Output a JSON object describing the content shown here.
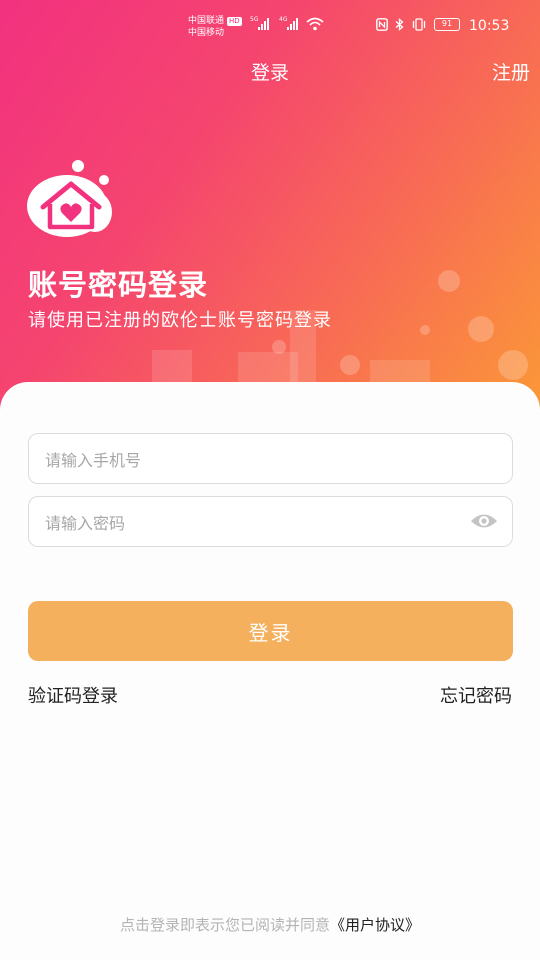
{
  "status_bar": {
    "carrier1": "中国联通",
    "carrier1_badge": "HD",
    "carrier2": "中国移动",
    "net1": "5G",
    "net2": "4G",
    "battery": "91",
    "time": "10:53"
  },
  "nav": {
    "title": "登录",
    "register": "注册"
  },
  "hero": {
    "title": "账号密码登录",
    "subtitle": "请使用已注册的欧伦士账号密码登录"
  },
  "form": {
    "phone_placeholder": "请输入手机号",
    "password_placeholder": "请输入密码",
    "login_button": "登录",
    "sms_login": "验证码登录",
    "forgot_password": "忘记密码"
  },
  "agreement": {
    "prefix": "点击登录即表示您已阅读并同意",
    "link": "《用户协议》"
  },
  "colors": {
    "gradient_start": "#f2317f",
    "gradient_end": "#fb9a36",
    "button": "#f5b05e",
    "placeholder": "#a7a7a7"
  }
}
